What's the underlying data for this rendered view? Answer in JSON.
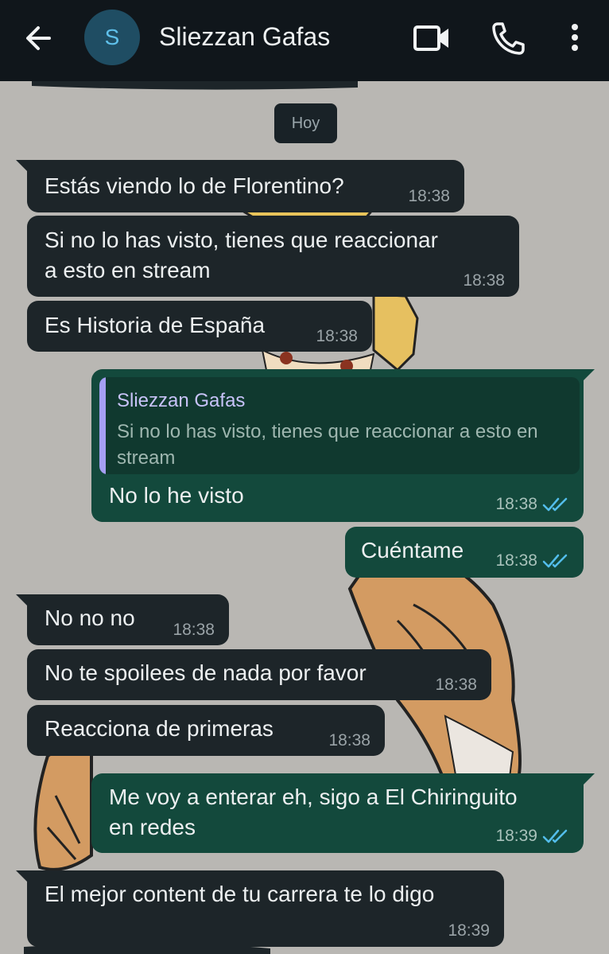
{
  "header": {
    "back_icon": "arrow-left-icon",
    "avatar_initial": "S",
    "contact_name": "Sliezzan Gafas",
    "video_icon": "video-camera-icon",
    "call_icon": "phone-icon",
    "menu_icon": "more-vertical-icon"
  },
  "colors": {
    "header_bg": "#10161b",
    "incoming_bubble": "#1d2529",
    "outgoing_bubble": "#13493c",
    "read_ticks": "#53bdeb",
    "quote_accent": "#a59ff3"
  },
  "date_chip": "Hoy",
  "messages": [
    {
      "dir": "in",
      "text": "Estás viendo lo de Florentino?",
      "time": "18:38"
    },
    {
      "dir": "in",
      "text": "Si no lo has visto, tienes que reaccionar\na esto en stream",
      "time": "18:38"
    },
    {
      "dir": "in",
      "text": "Es Historia de España",
      "time": "18:38"
    },
    {
      "dir": "out",
      "reply_to": {
        "name": "Sliezzan Gafas",
        "text": "Si no lo has visto, tienes que reaccionar a esto en stream"
      },
      "text": "No lo he visto",
      "time": "18:38",
      "status": "read"
    },
    {
      "dir": "out",
      "text": "Cuéntame",
      "time": "18:38",
      "status": "read"
    },
    {
      "dir": "in",
      "text": "No no no",
      "time": "18:38"
    },
    {
      "dir": "in",
      "text": "No te spoilees de nada por favor",
      "time": "18:38"
    },
    {
      "dir": "in",
      "text": "Reacciona de primeras",
      "time": "18:38"
    },
    {
      "dir": "out",
      "text": "Me voy a enterar eh, sigo a El Chiringuito\nen redes",
      "time": "18:39",
      "status": "read"
    },
    {
      "dir": "in",
      "text": "El mejor content de tu carrera te lo digo",
      "time": "18:39"
    }
  ]
}
